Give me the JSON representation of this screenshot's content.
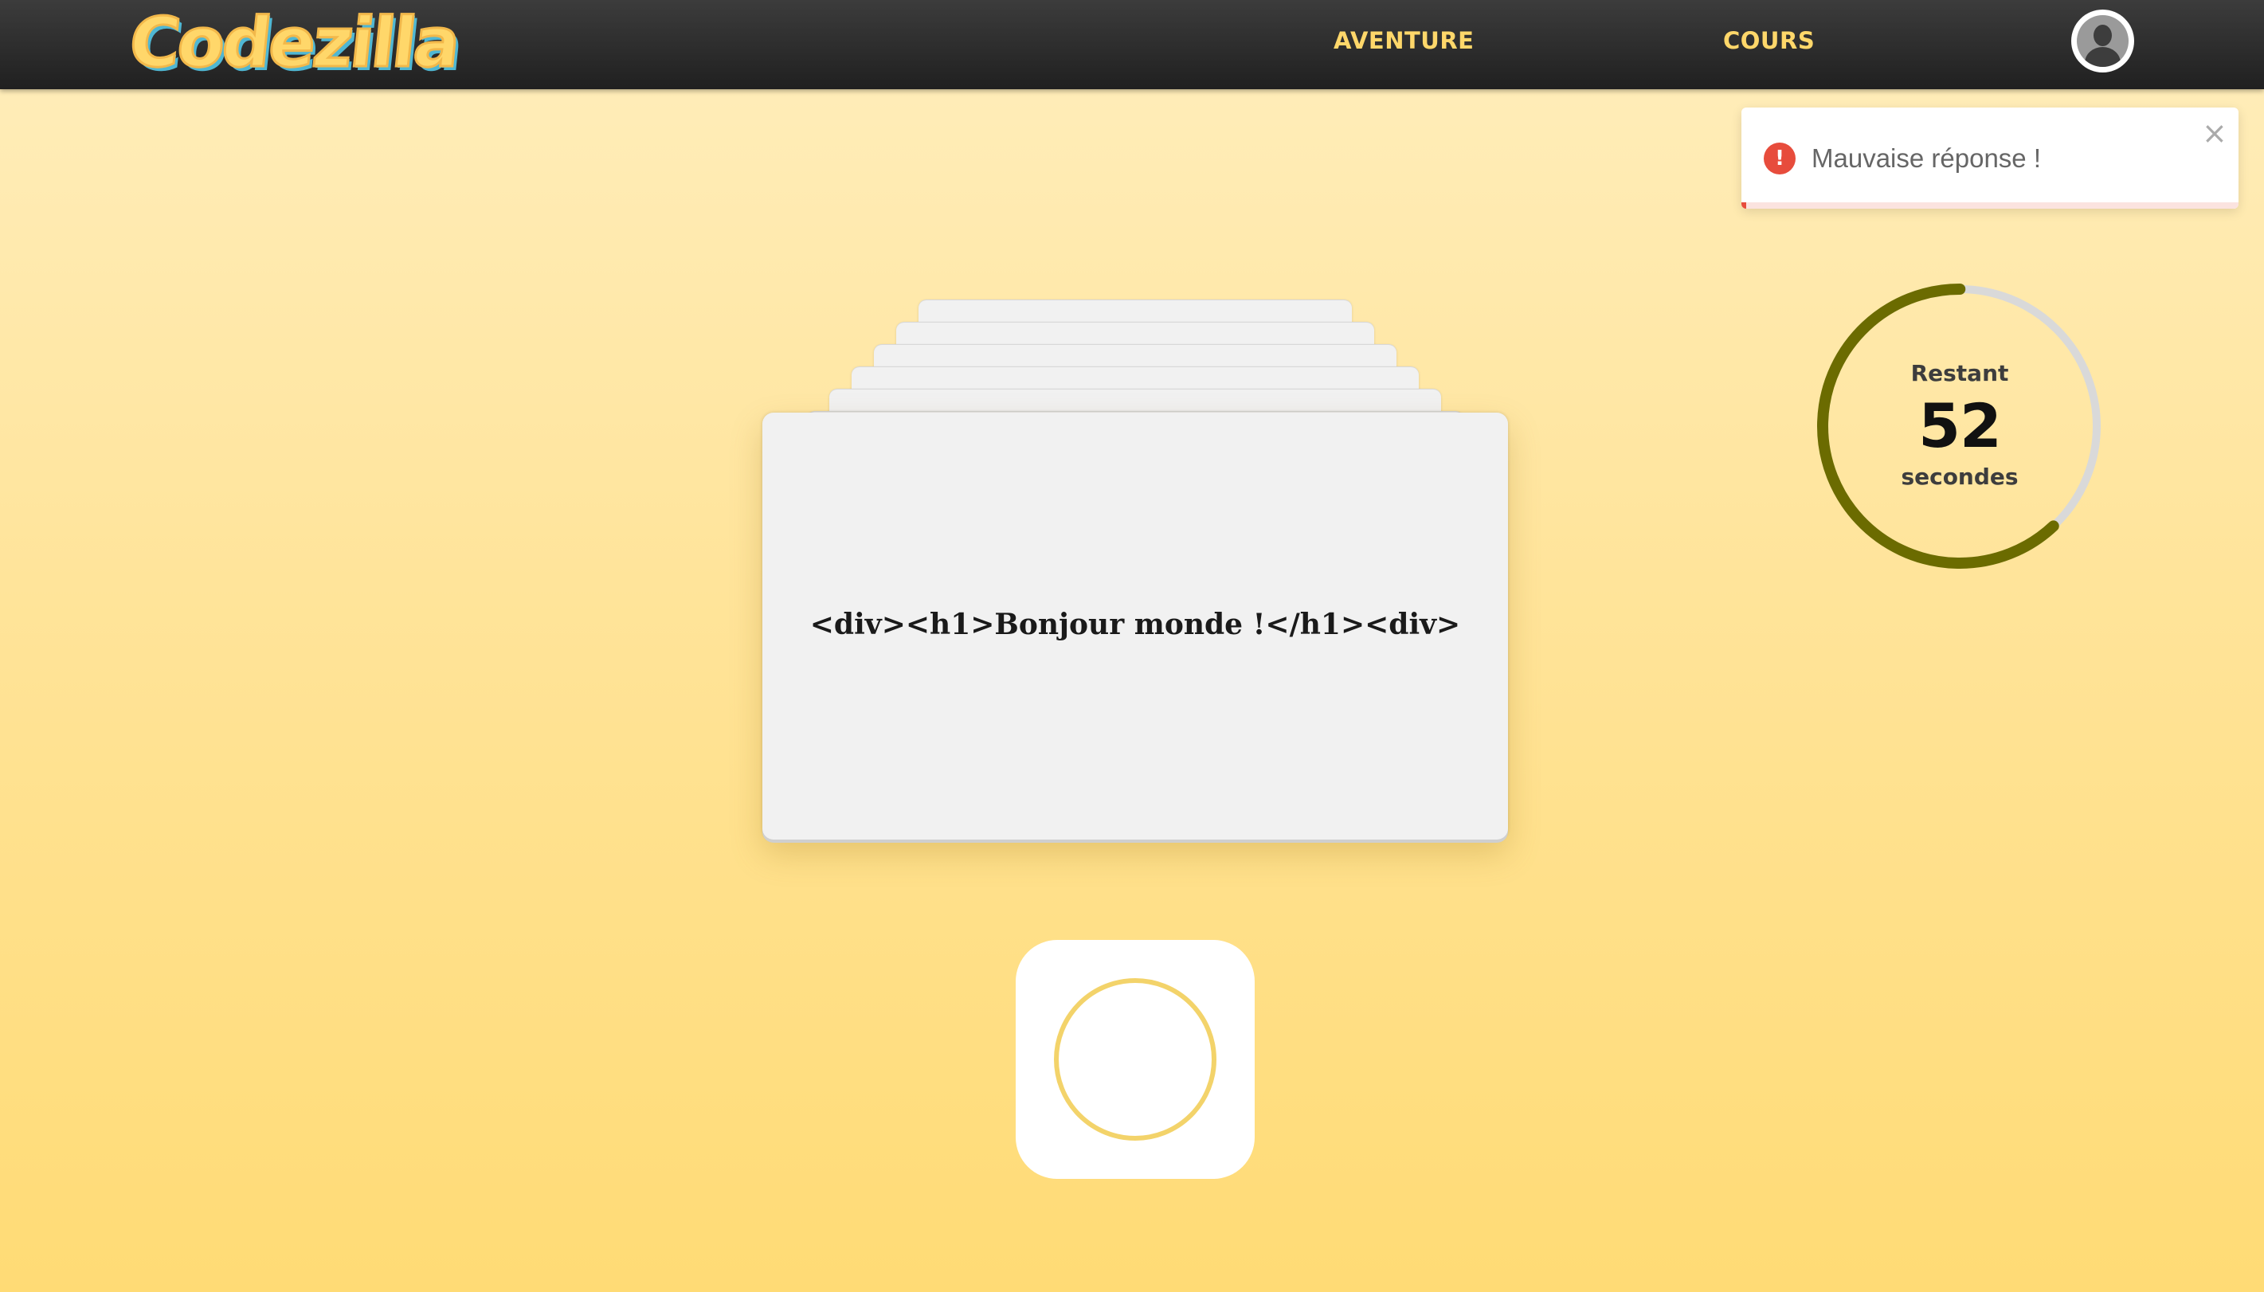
{
  "header": {
    "logo": "Codezilla",
    "nav": [
      {
        "label": "AVENTURE"
      },
      {
        "label": "COURS"
      }
    ],
    "avatar_icon": "user-avatar-icon"
  },
  "toast": {
    "icon": "error-icon",
    "message": "Mauvaise réponse !",
    "close": "×",
    "progress_remaining": 0.99,
    "accent_color": "#e74c3c"
  },
  "timer": {
    "label_top": "Restant",
    "value": "52",
    "label_bottom": "secondes",
    "fraction_remaining": 0.62,
    "ring_color": "#6b6b00",
    "track_color": "#d9d9d9"
  },
  "card": {
    "text": "<div><h1>Bonjour monde !</h1><div>",
    "stack_count": 7
  },
  "record_button": {
    "icon": "record-circle-icon",
    "ring_color": "#f3d36a"
  }
}
